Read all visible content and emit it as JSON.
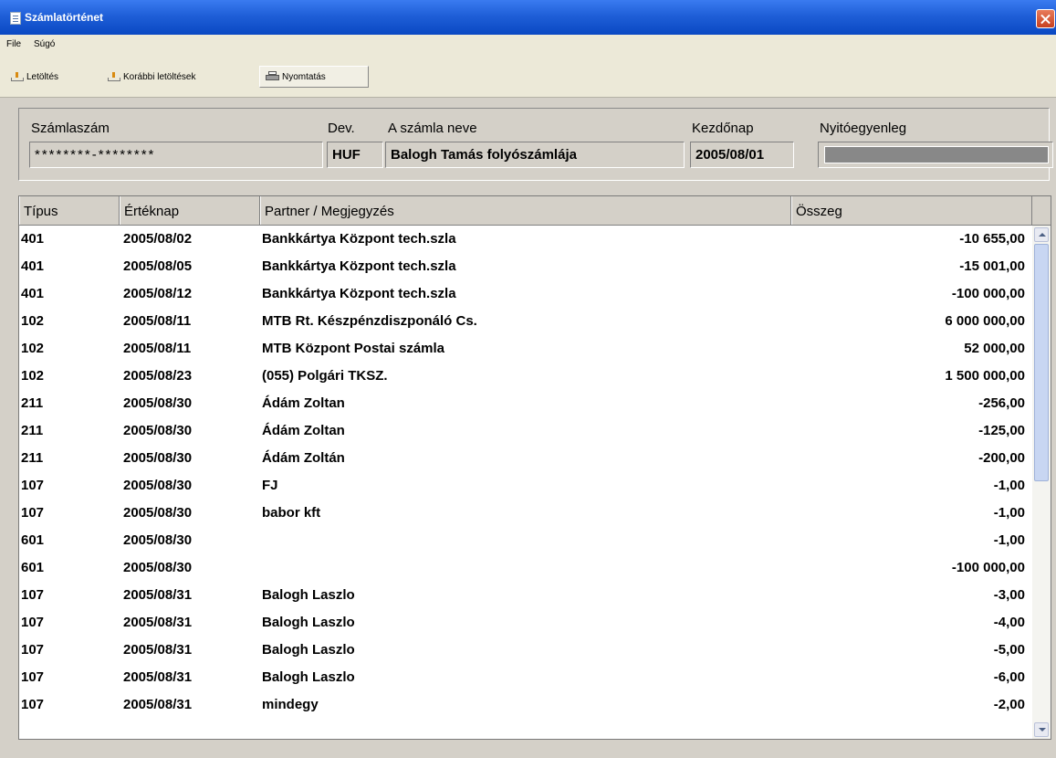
{
  "window": {
    "title": "Számlatörténet"
  },
  "menu": {
    "items": [
      "File",
      "Súgó"
    ]
  },
  "toolbar": {
    "download_label": "Letöltés",
    "previous_downloads_label": "Korábbi letöltések",
    "print_label": "Nyomtatás"
  },
  "header": {
    "labels": {
      "account_number": "Számlaszám",
      "currency": "Dev.",
      "account_name": "A számla neve",
      "start_date": "Kezdőnap",
      "opening_balance": "Nyitóegyenleg"
    },
    "values": {
      "account_number": "********-********",
      "currency": "HUF",
      "account_name": "Balogh Tamás folyószámlája",
      "start_date": "2005/08/01",
      "opening_balance": ""
    }
  },
  "table": {
    "columns": [
      "Típus",
      "Értéknap",
      "Partner / Megjegyzés",
      "Összeg"
    ],
    "rows": [
      {
        "type": "401",
        "date": "2005/08/02",
        "partner": "Bankkártya Központ tech.szla",
        "amount": "-10 655,00"
      },
      {
        "type": "401",
        "date": "2005/08/05",
        "partner": "Bankkártya Központ tech.szla",
        "amount": "-15 001,00"
      },
      {
        "type": "401",
        "date": "2005/08/12",
        "partner": "Bankkártya Központ tech.szla",
        "amount": "-100 000,00"
      },
      {
        "type": "102",
        "date": "2005/08/11",
        "partner": "MTB Rt. Készpénzdiszponáló Cs.",
        "amount": "6 000 000,00"
      },
      {
        "type": "102",
        "date": "2005/08/11",
        "partner": "MTB Központ Postai számla",
        "amount": "52 000,00"
      },
      {
        "type": "102",
        "date": "2005/08/23",
        "partner": "(055) Polgári TKSZ.",
        "amount": "1 500 000,00"
      },
      {
        "type": "211",
        "date": "2005/08/30",
        "partner": "Ádám Zoltan",
        "amount": "-256,00"
      },
      {
        "type": "211",
        "date": "2005/08/30",
        "partner": "Ádám Zoltan",
        "amount": "-125,00"
      },
      {
        "type": "211",
        "date": "2005/08/30",
        "partner": "Ádám Zoltán",
        "amount": "-200,00"
      },
      {
        "type": "107",
        "date": "2005/08/30",
        "partner": "FJ",
        "amount": "-1,00"
      },
      {
        "type": "107",
        "date": "2005/08/30",
        "partner": "babor kft",
        "amount": "-1,00"
      },
      {
        "type": "601",
        "date": "2005/08/30",
        "partner": "",
        "amount": "-1,00"
      },
      {
        "type": "601",
        "date": "2005/08/30",
        "partner": "",
        "amount": "-100 000,00"
      },
      {
        "type": "107",
        "date": "2005/08/31",
        "partner": "Balogh Laszlo",
        "amount": "-3,00"
      },
      {
        "type": "107",
        "date": "2005/08/31",
        "partner": "Balogh Laszlo",
        "amount": "-4,00"
      },
      {
        "type": "107",
        "date": "2005/08/31",
        "partner": "Balogh Laszlo",
        "amount": "-5,00"
      },
      {
        "type": "107",
        "date": "2005/08/31",
        "partner": "Balogh Laszlo",
        "amount": "-6,00"
      },
      {
        "type": "107",
        "date": "2005/08/31",
        "partner": "mindegy",
        "amount": "-2,00"
      }
    ]
  }
}
